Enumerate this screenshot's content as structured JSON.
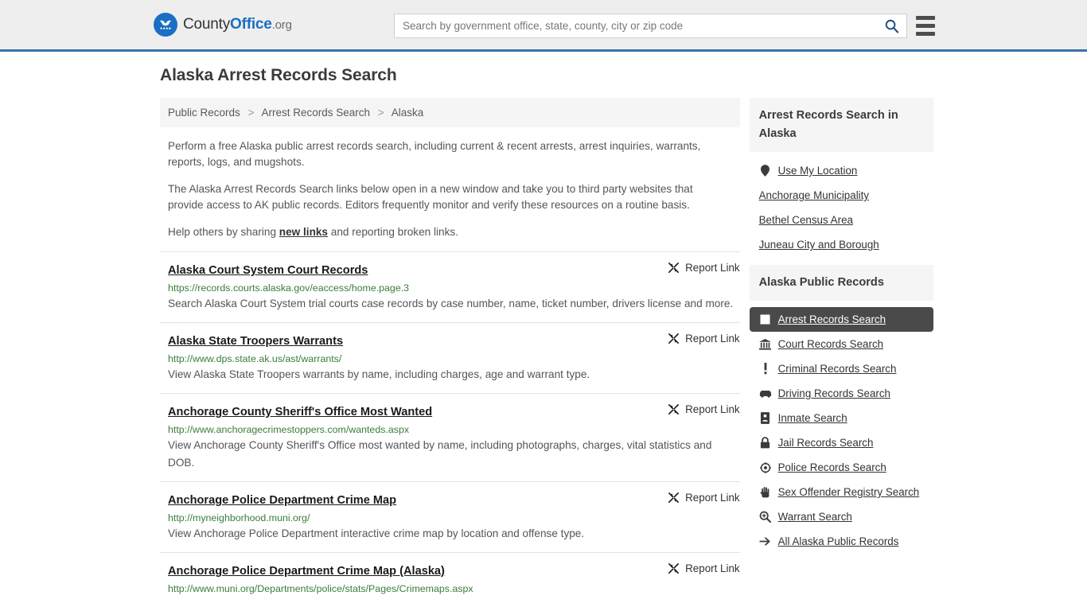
{
  "header": {
    "brand": {
      "part1": "County",
      "part2": "Office",
      "part3": ".org",
      "icon": "eagle-seal-icon"
    },
    "search": {
      "placeholder": "Search by government office, state, county, city or zip code",
      "value": "",
      "search_icon": "search-icon"
    },
    "menu_icon": "hamburger-menu-icon"
  },
  "page": {
    "title": "Alaska Arrest Records Search"
  },
  "breadcrumb": {
    "items": [
      {
        "label": "Public Records"
      },
      {
        "label": "Arrest Records Search"
      },
      {
        "label": "Alaska"
      }
    ],
    "separator": ">"
  },
  "intro": {
    "p1": "Perform a free Alaska public arrest records search, including current & recent arrests, arrest inquiries, warrants, reports, logs, and mugshots.",
    "p2": "The Alaska Arrest Records Search links below open in a new window and take you to third party websites that provide access to AK public records. Editors frequently monitor and verify these resources on a routine basis.",
    "p3_before": "Help others by sharing ",
    "p3_link": "new links",
    "p3_after": " and reporting broken links."
  },
  "report_label": "Report Link",
  "report_icon": "broken-link-icon",
  "results": [
    {
      "title": "Alaska Court System Court Records",
      "url": "https://records.courts.alaska.gov/eaccess/home.page.3",
      "desc": "Search Alaska Court System trial courts case records by case number, name, ticket number, drivers license and more."
    },
    {
      "title": "Alaska State Troopers Warrants",
      "url": "http://www.dps.state.ak.us/ast/warrants/",
      "desc": "View Alaska State Troopers warrants by name, including charges, age and warrant type."
    },
    {
      "title": "Anchorage County Sheriff's Office Most Wanted",
      "url": "http://www.anchoragecrimestoppers.com/wanteds.aspx",
      "desc": "View Anchorage County Sheriff's Office most wanted by name, including photographs, charges, vital statistics and DOB."
    },
    {
      "title": "Anchorage Police Department Crime Map",
      "url": "http://myneighborhood.muni.org/",
      "desc": "View Anchorage Police Department interactive crime map by location and offense type."
    },
    {
      "title": "Anchorage Police Department Crime Map (Alaska)",
      "url": "http://www.muni.org/Departments/police/stats/Pages/Crimemaps.aspx",
      "desc": ""
    }
  ],
  "sidebar": {
    "panel1": {
      "heading": "Arrest Records Search in Alaska",
      "items": [
        {
          "label": "Use My Location",
          "icon": "map-pin-icon",
          "active": false
        },
        {
          "label": "Anchorage Municipality",
          "icon": "",
          "active": false
        },
        {
          "label": "Bethel Census Area",
          "icon": "",
          "active": false
        },
        {
          "label": "Juneau City and Borough",
          "icon": "",
          "active": false
        }
      ]
    },
    "panel2": {
      "heading": "Alaska Public Records",
      "items": [
        {
          "label": "Arrest Records Search",
          "icon": "id-card-icon",
          "active": true
        },
        {
          "label": "Court Records Search",
          "icon": "courthouse-icon",
          "active": false
        },
        {
          "label": "Criminal Records Search",
          "icon": "exclamation-icon",
          "active": false
        },
        {
          "label": "Driving Records Search",
          "icon": "car-icon",
          "active": false
        },
        {
          "label": "Inmate Search",
          "icon": "inmate-badge-icon",
          "active": false
        },
        {
          "label": "Jail Records Search",
          "icon": "lock-icon",
          "active": false
        },
        {
          "label": "Police Records Search",
          "icon": "police-badge-icon",
          "active": false
        },
        {
          "label": "Sex Offender Registry Search",
          "icon": "hand-icon",
          "active": false
        },
        {
          "label": "Warrant Search",
          "icon": "magnifier-plus-icon",
          "active": false
        },
        {
          "label": "All Alaska Public Records",
          "icon": "arrow-right-icon",
          "active": false
        }
      ]
    }
  },
  "colors": {
    "brand_blue": "#1a6fc4",
    "header_bg": "#eeeeee",
    "header_border": "#3a72a8",
    "url_green": "#3a7d3a",
    "active_bg": "#4a4a4a",
    "panel_bg": "#f5f5f5"
  }
}
